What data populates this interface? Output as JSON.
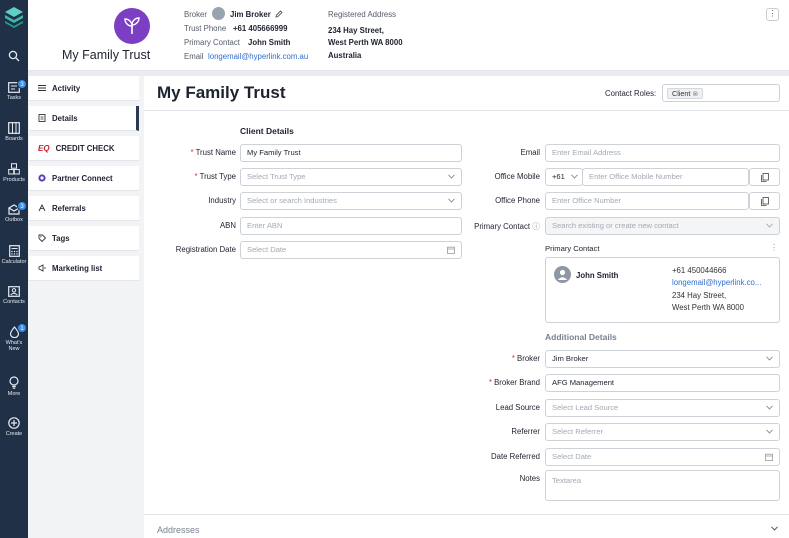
{
  "nav": {
    "items": [
      {
        "label": "",
        "icon": "search-icon"
      },
      {
        "label": "Tasks",
        "icon": "tasks-icon",
        "badge": "3"
      },
      {
        "label": "Boards",
        "icon": "boards-icon"
      },
      {
        "label": "Products",
        "icon": "products-icon"
      },
      {
        "label": "Outbox",
        "icon": "outbox-icon",
        "badge": "3"
      },
      {
        "label": "Calculator",
        "icon": "calculator-icon"
      },
      {
        "label": "Contacts",
        "icon": "contacts-icon"
      },
      {
        "label": "What's New",
        "icon": "whats-new-icon",
        "badge": "1"
      },
      {
        "label": "More",
        "icon": "more-icon"
      },
      {
        "label": "Create",
        "icon": "create-icon"
      }
    ]
  },
  "header": {
    "trust_name": "My Family Trust",
    "broker_label": "Broker",
    "broker_name": "Jim Broker",
    "trust_phone_label": "Trust Phone",
    "trust_phone": "+61 405666999",
    "primary_contact_label": "Primary Contact",
    "primary_contact": "John Smith",
    "email_label": "Email",
    "email": "longemail@hyperlink.com.au",
    "registered_address_label": "Registered Address",
    "address_line1": "234 Hay Street,",
    "address_line2": "West Perth WA 8000",
    "address_line3": "Australia"
  },
  "tabs": [
    {
      "label": "Activity",
      "icon": "list-icon"
    },
    {
      "label": "Details",
      "icon": "document-icon",
      "active": true
    },
    {
      "label": "CREDIT CHECK",
      "icon": "eq-logo-icon"
    },
    {
      "label": "Partner Connect",
      "icon": "partner-connect-icon"
    },
    {
      "label": "Referrals",
      "icon": "referrals-icon"
    },
    {
      "label": "Tags",
      "icon": "tag-icon"
    },
    {
      "label": "Marketing list",
      "icon": "megaphone-icon"
    }
  ],
  "main": {
    "title": "My Family Trust",
    "contact_roles_label": "Contact Roles:",
    "contact_role_chip": "Client",
    "client_details_title": "Client Details",
    "trust_name_label": "Trust Name",
    "trust_name_value": "My Family Trust",
    "trust_type_label": "Trust Type",
    "trust_type_placeholder": "Select Trust Type",
    "industry_label": "Industry",
    "industry_placeholder": "Select or search Industries",
    "abn_label": "ABN",
    "abn_placeholder": "Enter ABN",
    "registration_date_label": "Registration Date",
    "registration_date_placeholder": "Select Date",
    "email_label": "Email",
    "email_placeholder": "Enter Email Address",
    "office_mobile_label": "Office Mobile",
    "office_mobile_code": "+61",
    "office_mobile_placeholder": "Enter Office Mobile Number",
    "office_phone_label": "Office Phone",
    "office_phone_placeholder": "Enter Office Number",
    "primary_contact_label": "Primary Contact",
    "primary_contact_placeholder": "Search existing or create new contact",
    "primary_contact_card_title": "Primary Contact",
    "pc_name": "John Smith",
    "pc_phone": "+61 450044666",
    "pc_email": "longemail@hyperlink.co...",
    "pc_address1": "234 Hay Street,",
    "pc_address2": "West Perth WA 8000",
    "additional_details_title": "Additional Details",
    "broker_label": "Broker",
    "broker_value": "Jim Broker",
    "broker_brand_label": "Broker Brand",
    "broker_brand_value": "AFG Management",
    "lead_source_label": "Lead Source",
    "lead_source_placeholder": "Select Lead Source",
    "referrer_label": "Referrer",
    "referrer_placeholder": "Select Referrer",
    "date_referred_label": "Date Referred",
    "date_referred_placeholder": "Select Date",
    "notes_label": "Notes",
    "notes_placeholder": "Textarea",
    "addresses_title": "Addresses"
  },
  "colors": {
    "nav_bg": "#1f3047",
    "brand_purple": "#7c3fc4",
    "link": "#2f6fd1",
    "badge": "#3a8ee6",
    "required": "#dd3333"
  }
}
